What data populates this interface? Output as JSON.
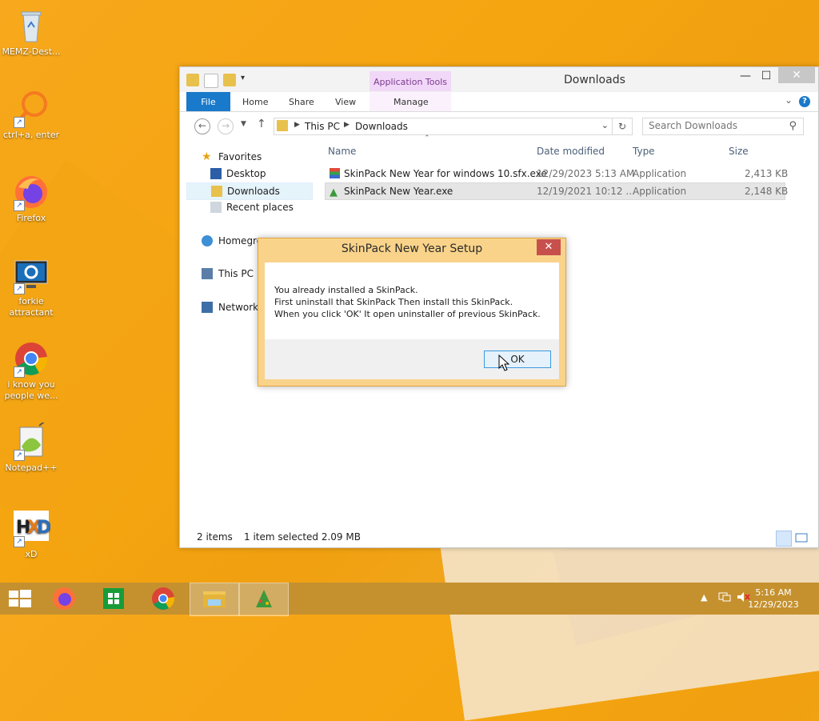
{
  "desktop": {
    "icons": [
      {
        "label": "MEMZ-Dest...",
        "icon": "recycle-bin"
      },
      {
        "label": "ctrl+a, enter",
        "icon": "shortcut-magnifier"
      },
      {
        "label": "Firefox",
        "icon": "firefox"
      },
      {
        "label": "forkie attractant",
        "icon": "pc-settings"
      },
      {
        "label": "i know you people we...",
        "icon": "chrome"
      },
      {
        "label": "Notepad++",
        "icon": "notepad-plus-plus"
      },
      {
        "label": "xD",
        "icon": "hxd"
      }
    ]
  },
  "explorer": {
    "title": "Downloads",
    "contextual_tab": "Application Tools",
    "ribbon_tabs": {
      "file": "File",
      "home": "Home",
      "share": "Share",
      "view": "View",
      "manage": "Manage"
    },
    "breadcrumb": {
      "root": "This PC",
      "folder": "Downloads"
    },
    "search_placeholder": "Search Downloads",
    "nav": {
      "favorites": "Favorites",
      "desktop": "Desktop",
      "downloads": "Downloads",
      "recent": "Recent places",
      "homegroup": "Homegro",
      "thispc": "This PC",
      "network": "Network"
    },
    "columns": {
      "name": "Name",
      "date": "Date modified",
      "type": "Type",
      "size": "Size"
    },
    "files": [
      {
        "name": "SkinPack New Year for windows 10.sfx.exe",
        "date": "12/29/2023 5:13 AM",
        "type": "Application",
        "size": "2,413 KB"
      },
      {
        "name": "SkinPack New Year.exe",
        "date": "12/19/2021 10:12 ...",
        "type": "Application",
        "size": "2,148 KB"
      }
    ],
    "status": {
      "count": "2 items",
      "selection": "1 item selected  2.09 MB"
    }
  },
  "dialog": {
    "title": "SkinPack New Year Setup",
    "lines": [
      "You already installed a SkinPack.",
      "First uninstall that SkinPack Then install this SkinPack.",
      "When you click 'OK' It open uninstaller of previous SkinPack."
    ],
    "ok": "OK"
  },
  "taskbar": {
    "time": "5:16 AM",
    "date": "12/29/2023"
  },
  "colors": {
    "accent": "#1979ca",
    "desktop": "#f5a50f",
    "dialog_frame": "#f9d38a"
  }
}
